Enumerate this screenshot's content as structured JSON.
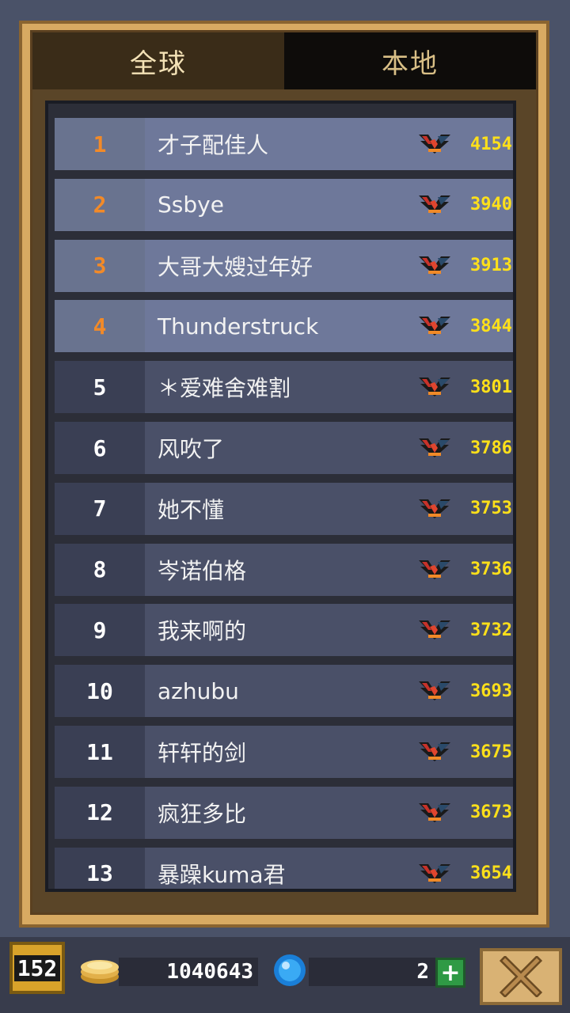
{
  "tabs": {
    "global": "全球",
    "local": "本地"
  },
  "leaderboard": [
    {
      "rank": "1",
      "name": "才子配佳人",
      "score": "4154"
    },
    {
      "rank": "2",
      "name": "Ssbye",
      "score": "3940"
    },
    {
      "rank": "3",
      "name": "大哥大嫂过年好",
      "score": "3913"
    },
    {
      "rank": "4",
      "name": "Thunderstruck",
      "score": "3844"
    },
    {
      "rank": "5",
      "name": "＊爱难舍难割",
      "score": "3801"
    },
    {
      "rank": "6",
      "name": "风吹了",
      "score": "3786"
    },
    {
      "rank": "7",
      "name": "她不懂",
      "score": "3753"
    },
    {
      "rank": "8",
      "name": "岑诺伯格",
      "score": "3736"
    },
    {
      "rank": "9",
      "name": "我来啊的",
      "score": "3732"
    },
    {
      "rank": "10",
      "name": "azhubu",
      "score": "3693"
    },
    {
      "rank": "11",
      "name": "轩轩的剑",
      "score": "3675"
    },
    {
      "rank": "12",
      "name": "疯狂多比",
      "score": "3673"
    },
    {
      "rank": "13",
      "name": "暴躁kuma君",
      "score": "3654"
    }
  ],
  "footer": {
    "level": "152",
    "coins": "1040643",
    "gems": "2"
  },
  "icons": {
    "rank_badge": "wing-badge-icon",
    "coin": "coin-stack-icon",
    "gem": "blue-gem-icon",
    "plus": "plus-icon",
    "close": "close-x-icon"
  }
}
